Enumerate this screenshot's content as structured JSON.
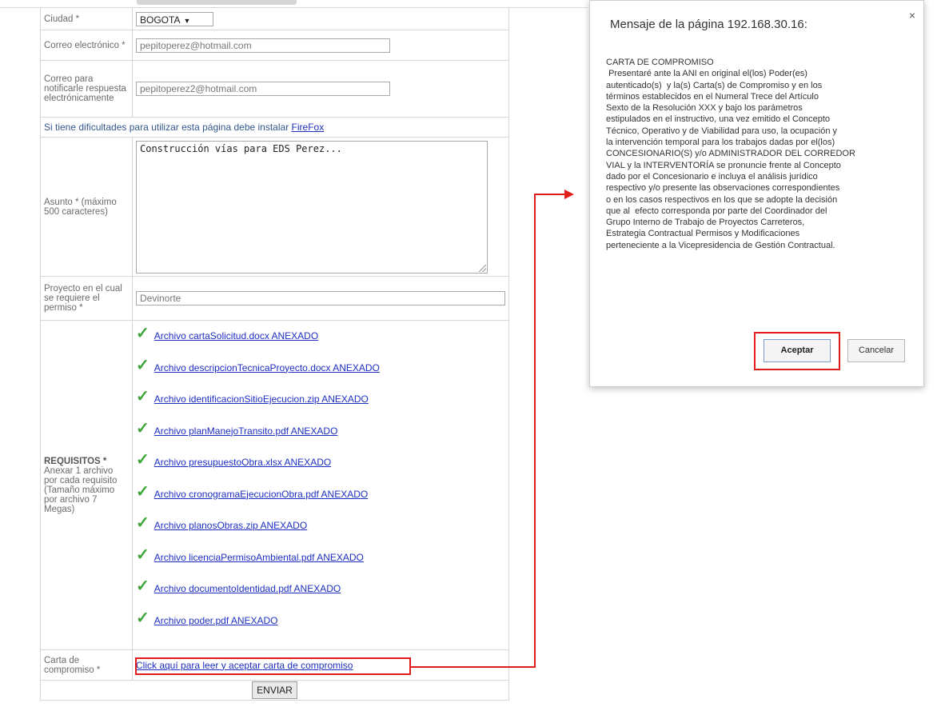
{
  "form": {
    "ciudad": {
      "label": "Ciudad *",
      "value": "BOGOTA"
    },
    "correo": {
      "label": "Correo electrónico *",
      "value": "pepitoperez@hotmail.com"
    },
    "correo_notificar": {
      "label": "Correo para notificarle respuesta electrónicamente",
      "value": "pepitoperez2@hotmail.com"
    },
    "help": {
      "text": "Si tiene dificultades para utilizar esta página debe instalar",
      "link": "FireFox"
    },
    "asunto": {
      "label": "Asunto * (máximo 500 caracteres)",
      "value": "Construcción vías para EDS Perez..."
    },
    "proyecto": {
      "label": "Proyecto en el cual se requiere el permiso *",
      "value": "Devinorte"
    },
    "requisitos": {
      "title": "REQUISITOS *",
      "desc": "Anexar 1 archivo por cada requisito (Tamaño máximo por archivo 7 Megas)",
      "files": [
        "Archivo cartaSolicitud.docx ANEXADO",
        "Archivo descripcionTecnicaProyecto.docx ANEXADO",
        "Archivo identificacionSitioEjecucion.zip ANEXADO",
        "Archivo planManejoTransito.pdf ANEXADO",
        "Archivo presupuestoObra.xlsx ANEXADO",
        "Archivo cronogramaEjecucionObra.pdf ANEXADO",
        "Archivo planosObras.zip ANEXADO",
        "Archivo licenciaPermisoAmbiental.pdf ANEXADO",
        "Archivo documentoIdentidad.pdf ANEXADO",
        "Archivo poder.pdf ANEXADO"
      ]
    },
    "carta": {
      "label": "Carta de compromiso *",
      "link": "Click aquí para leer y aceptar carta de compromiso"
    },
    "submit_label": "ENVIAR"
  },
  "dialog": {
    "title": "Mensaje de la página 192.168.30.16:",
    "message": "CARTA DE COMPROMISO\n Presentaré ante la ANI en original el(los) Poder(es)\nautenticado(s)  y la(s) Carta(s) de Compromiso y en los\ntérminos establecidos en el Numeral Trece del Artículo\nSexto de la Resolución XXX y bajo los parámetros\nestipulados en el instructivo, una vez emitido el Concepto\nTécnico, Operativo y de Viabilidad para uso, la ocupación y\nla intervención temporal para los trabajos dadas por el(los)\nCONCESIONARIO(S) y/o ADMINISTRADOR DEL CORREDOR\nVIAL y la INTERVENTORÍA se pronuncie frente al Concepto\ndado por el Concesionario e incluya el análisis jurídico\nrespectivo y/o presente las observaciones correspondientes\no en los casos respectivos en los que se adopte la decisión\nque al  efecto corresponda por parte del Coordinador del\nGrupo Interno de Trabajo de Proyectos Carreteros,\nEstrategia Contractual Permisos y Modificaciones\nperteneciente a la Vicepresidencia de Gestión Contractual.",
    "accept_label": "Aceptar",
    "cancel_label": "Cancelar",
    "close_glyph": "×"
  },
  "colors": {
    "highlight": "#e21b1b",
    "link": "#1d2fc2",
    "check": "#3ea53a"
  }
}
